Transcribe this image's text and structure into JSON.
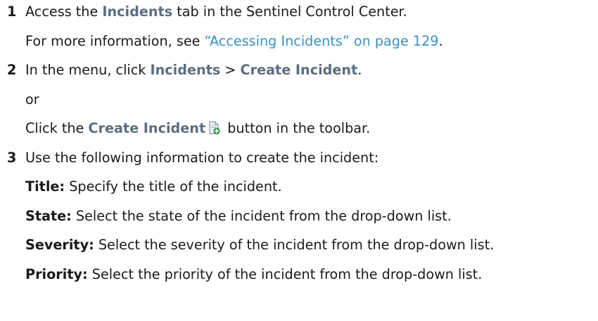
{
  "steps": [
    {
      "number": "1",
      "text_a": "Access the ",
      "ui": "Incidents",
      "text_b": " tab in the Sentinel Control Center.",
      "info_a": "For more information, see ",
      "info_link": "“Accessing Incidents” on page 129",
      "info_b": "."
    },
    {
      "number": "2",
      "text_a": "In the menu, click ",
      "ui_menu": "Incidents",
      "sep": " > ",
      "ui_item": "Create Incident",
      "text_b": ".",
      "or": "or",
      "alt_a": "Click the ",
      "alt_ui": "Create Incident",
      "alt_b": " button in the toolbar.",
      "alt_icon": "create-incident-icon"
    },
    {
      "number": "3",
      "text": "Use the following information to create the incident:",
      "fields": [
        {
          "term": "Title:",
          "desc": " Specify the title of the incident."
        },
        {
          "term": "State:",
          "desc": " Select the state of the incident from the drop-down list."
        },
        {
          "term": "Severity:",
          "desc": " Select the severity of the incident from the drop-down list."
        },
        {
          "term": "Priority:",
          "desc": " Select the priority of the incident from the drop-down list."
        }
      ]
    }
  ]
}
